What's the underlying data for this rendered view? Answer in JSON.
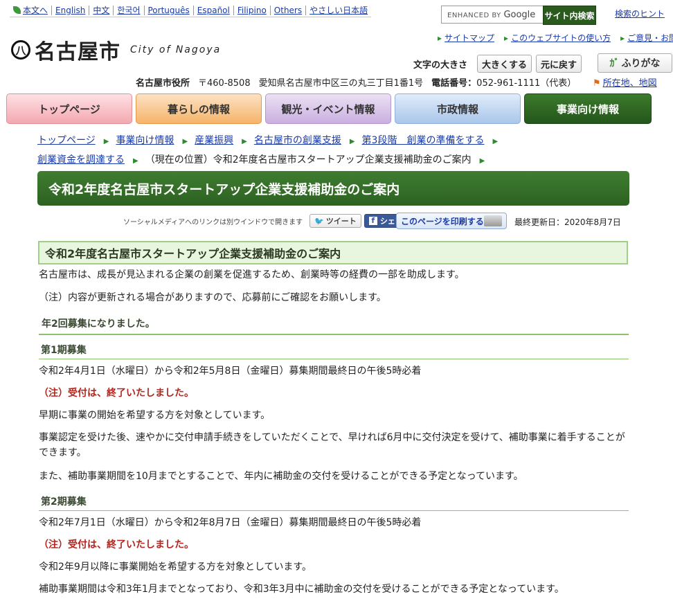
{
  "langbar": {
    "items": [
      "本文へ",
      "English",
      "中文",
      "한국어",
      "Português",
      "Español",
      "Filipino",
      "Others",
      "やさしい日本語"
    ]
  },
  "search": {
    "enhanced_label": "ENHANCED BY",
    "google": "Google",
    "button": "サイト内検索",
    "hint": "検索のヒント"
  },
  "header": {
    "logo_mark": "八",
    "logo_name": "名古屋市",
    "logo_en": "City of Nagoya",
    "utility": [
      "サイトマップ",
      "このウェブサイトの使い方",
      "ご意見・お問い合せ"
    ],
    "fontsize_label": "文字の大きさ",
    "enlarge": "大きくする",
    "reset": "元に戻す",
    "furigana": "ふりがな",
    "office": "名古屋市役所",
    "postal": "〒460-8508",
    "address": "愛知県名古屋市中区三の丸三丁目1番1号",
    "phone_label": "電話番号：",
    "phone": "052-961-1111（代表）",
    "map_link": "所在地、地図"
  },
  "tabs": [
    "トップページ",
    "暮らしの情報",
    "観光・イベント情報",
    "市政情報",
    "事業向け情報"
  ],
  "breadcrumb": {
    "items": [
      "トップページ",
      "事業向け情報",
      "産業振興",
      "名古屋市の創業支援",
      "第3段階　創業の準備をする",
      "創業資金を調達する"
    ],
    "current": "（現在の位置）令和2年度名古屋市スタートアップ企業支援補助金のご案内"
  },
  "page_title": "令和2年度名古屋市スタートアップ企業支援補助金のご案内",
  "social": {
    "note": "ソーシャルメディアへのリンクは別ウインドウで開きます",
    "tweet": "ツイート",
    "share": "シェア",
    "print": "このページを印刷する",
    "updated": "最終更新日：2020年8月7日"
  },
  "content": {
    "heading": "令和2年度名古屋市スタートアップ企業支援補助金のご案内",
    "intro": "名古屋市は、成長が見込まれる企業の創業を促進するため、創業時等の経費の一部を助成します。",
    "note": "（注）内容が更新される場合がありますので、応募前にご確認をお願いします。",
    "h3": "年2回募集になりました。",
    "round1": {
      "title": "第1期募集",
      "period": "令和2年4月1日（水曜日）から令和2年5月8日（金曜日）募集期間最終日の午後5時必着",
      "closed": "（注）受付は、終了いたしました。",
      "p1": "早期に事業の開始を希望する方を対象としています。",
      "p2": "事業認定を受けた後、速やかに交付申請手続きをしていただくことで、早ければ6月中に交付決定を受けて、補助事業に着手することができます。",
      "p3": "また、補助事業期間を10月までとすることで、年内に補助金の交付を受けることができる予定となっています。"
    },
    "round2": {
      "title": "第2期募集",
      "period": "令和2年7月1日（水曜日）から令和2年8月7日（金曜日）募集期間最終日の午後5時必着",
      "closed": "（注）受付は、終了いたしました。",
      "p1": "令和2年9月以降に事業開始を希望する方を対象としています。",
      "p2": "補助事業期間は令和3年1月までとなっており、令和3年3月中に補助金の交付を受けることができる予定となっています。"
    }
  }
}
